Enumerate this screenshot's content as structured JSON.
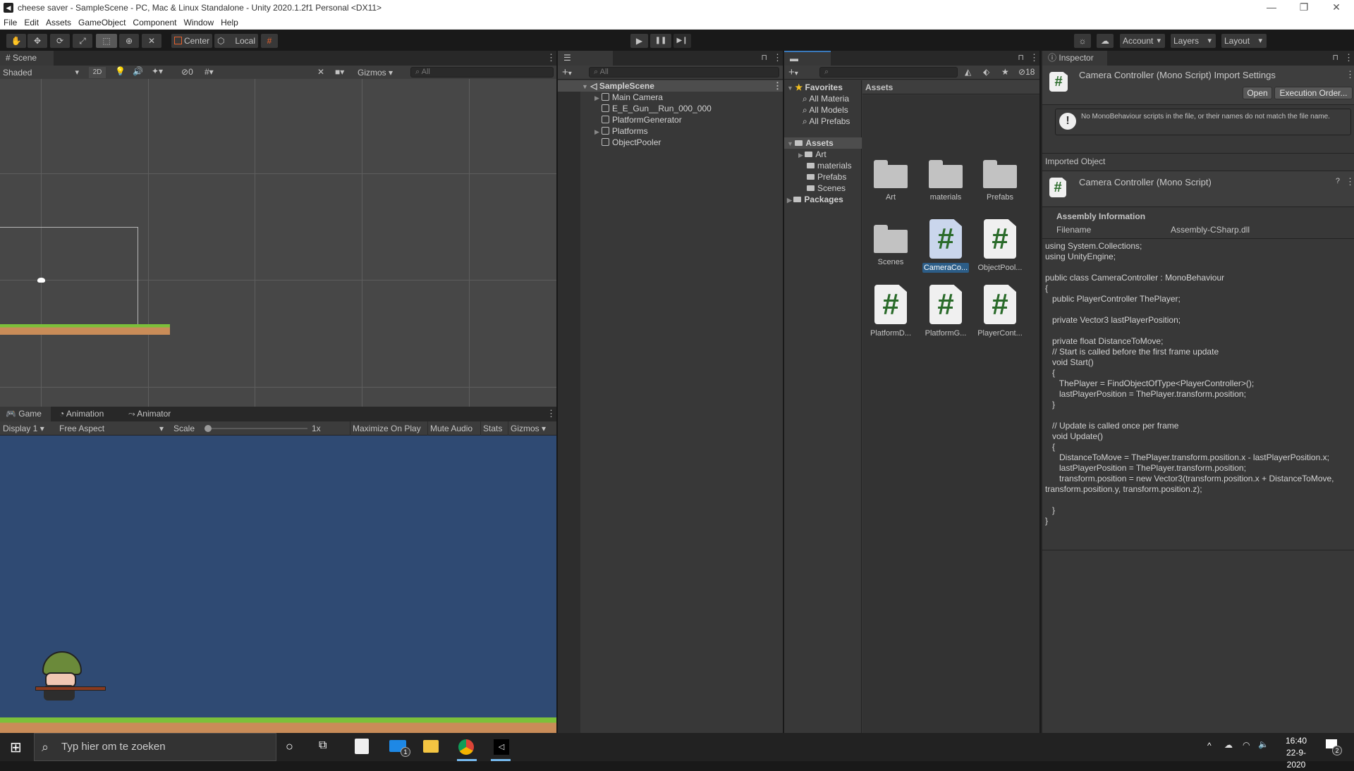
{
  "window": {
    "title": "cheese saver - SampleScene - PC, Mac & Linux Standalone - Unity 2020.1.2f1 Personal <DX11>",
    "controls": {
      "minimize": "—",
      "maximize": "❐",
      "close": "✕"
    }
  },
  "menu": [
    "File",
    "Edit",
    "Assets",
    "GameObject",
    "Component",
    "Window",
    "Help"
  ],
  "toolbar": {
    "tools": [
      "hand-tool",
      "move-tool",
      "rotate-tool",
      "scale-tool",
      "rect-tool",
      "transform-tool",
      "custom-tool"
    ],
    "active_tool": "rect-tool",
    "pivot_label": "Center",
    "space_label": "Local",
    "play": {
      "play": "▶",
      "pause": "❚❚",
      "step": "▶❙"
    },
    "account_label": "Account",
    "layers_label": "Layers",
    "layout_label": "Layout"
  },
  "scene": {
    "tab_label": "Scene",
    "shading_mode": "Shaded",
    "mode_2d": "2D",
    "hidden_count": "0",
    "gizmos_label": "Gizmos",
    "search_placeholder": "All"
  },
  "game": {
    "tabs": [
      {
        "label": "Game",
        "icon": "gamepad-icon"
      },
      {
        "label": "Animation",
        "icon": "animation-icon"
      },
      {
        "label": "Animator",
        "icon": "animator-icon"
      }
    ],
    "display": "Display 1",
    "aspect": "Free Aspect",
    "scale_label": "Scale",
    "scale_value": "1x",
    "scale_slider_fraction": 0.0,
    "maximize_label": "Maximize On Play",
    "mute_label": "Mute Audio",
    "stats_label": "Stats",
    "gizmos_label": "Gizmos",
    "background_color": "#2f4a73"
  },
  "hierarchy": {
    "tab_label": "Hierarchy",
    "search_placeholder": "All",
    "scene_name": "SampleScene",
    "items": [
      {
        "label": "Main Camera",
        "expandable": true
      },
      {
        "label": "E_E_Gun__Run_000_000",
        "expandable": false
      },
      {
        "label": "PlatformGenerator",
        "expandable": false
      },
      {
        "label": "Platforms",
        "expandable": true
      },
      {
        "label": "ObjectPooler",
        "expandable": false
      }
    ]
  },
  "project": {
    "tab_label": "Project",
    "hidden_packages_count": "18",
    "favorites_label": "Favorites",
    "favorites": [
      "All Materia",
      "All Models",
      "All Prefabs"
    ],
    "assets_label": "Assets",
    "asset_folders": [
      {
        "label": "Art",
        "expandable": true
      },
      {
        "label": "materials",
        "expandable": false
      },
      {
        "label": "Prefabs",
        "expandable": false
      },
      {
        "label": "Scenes",
        "expandable": false
      }
    ],
    "packages_label": "Packages",
    "breadcrumb": "Assets",
    "grid_items": [
      {
        "label": "Art",
        "type": "folder",
        "selected": false
      },
      {
        "label": "materials",
        "type": "folder",
        "selected": false
      },
      {
        "label": "Prefabs",
        "type": "folder",
        "selected": false
      },
      {
        "label": "Scenes",
        "type": "folder",
        "selected": false
      },
      {
        "label": "CameraCo...",
        "type": "script",
        "selected": true
      },
      {
        "label": "ObjectPool...",
        "type": "script",
        "selected": false
      },
      {
        "label": "PlatformD...",
        "type": "script",
        "selected": false
      },
      {
        "label": "PlatformG...",
        "type": "script",
        "selected": false
      },
      {
        "label": "PlayerCont...",
        "type": "script",
        "selected": false
      }
    ]
  },
  "inspector": {
    "tab_label": "Inspector",
    "header_title": "Camera Controller (Mono Script) Import Settings",
    "open_button": "Open",
    "execution_order_button": "Execution Order...",
    "warning": "No MonoBehaviour scripts in the file, or their names do not match the file name.",
    "imported_object_label": "Imported Object",
    "imported_title": "Camera Controller (Mono Script)",
    "assembly_info_label": "Assembly Information",
    "filename_label": "Filename",
    "filename_value": "Assembly-CSharp.dll",
    "code": "using System.Collections;\nusing UnityEngine;\n\npublic class CameraController : MonoBehaviour\n{\n   public PlayerController ThePlayer;\n\n   private Vector3 lastPlayerPosition;\n\n   private float DistanceToMove;\n   // Start is called before the first frame update\n   void Start()\n   {\n      ThePlayer = FindObjectOfType<PlayerController>();\n      lastPlayerPosition = ThePlayer.transform.position;\n   }\n\n   // Update is called once per frame\n   void Update()\n   {\n      DistanceToMove = ThePlayer.transform.position.x - lastPlayerPosition.x;\n      lastPlayerPosition = ThePlayer.transform.position;\n      transform.position = new Vector3(transform.position.x + DistanceToMove,\ntransform.position.y, transform.position.z);\n\n   }\n}"
  },
  "taskbar": {
    "search_placeholder": "Typ hier om te zoeken",
    "mail_badge": "1",
    "time": "16:40",
    "date": "22-9-2020",
    "notifications_badge": "2"
  }
}
